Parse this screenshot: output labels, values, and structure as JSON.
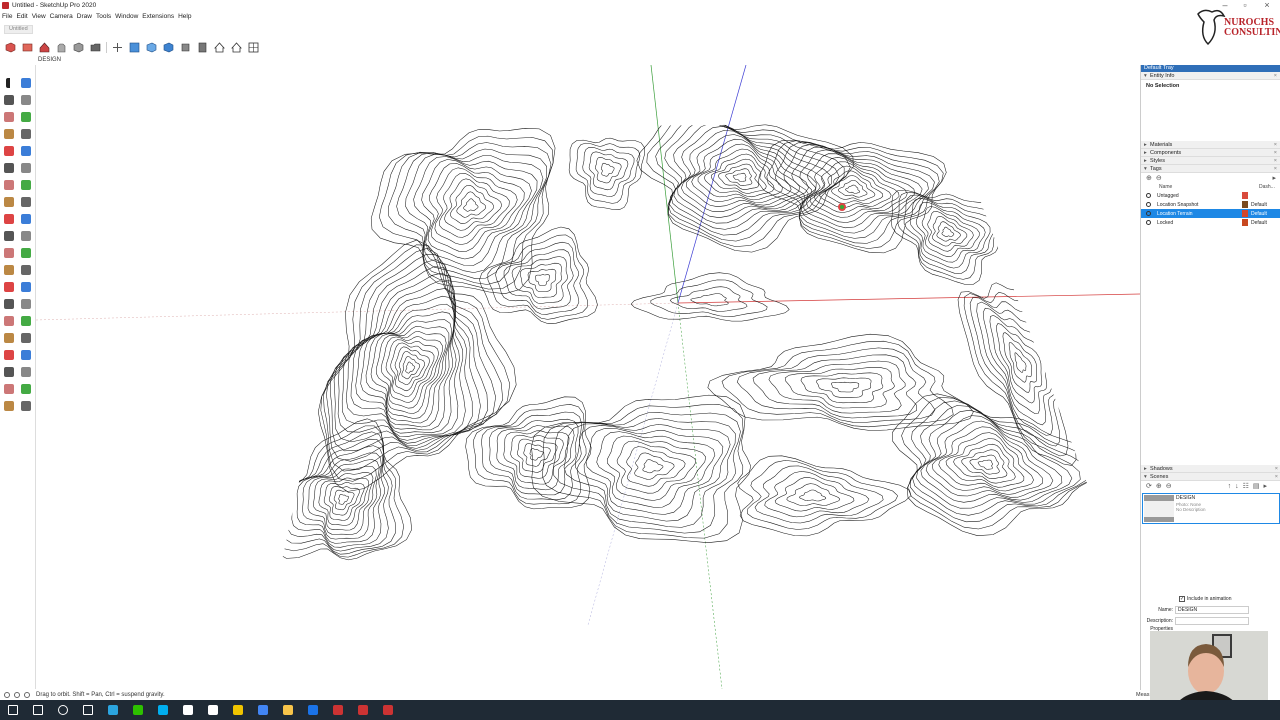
{
  "window": {
    "title": "Untitled - SketchUp Pro 2020"
  },
  "menu": [
    "File",
    "Edit",
    "View",
    "Camera",
    "Draw",
    "Tools",
    "Window",
    "Extensions",
    "Help"
  ],
  "doc_tab": "Untitled",
  "scene_tab": "DESIGN",
  "toolbar_icons": [
    "cube-icon",
    "wall-icon",
    "house-roof-icon",
    "hand-orbit-icon",
    "box-icon",
    "folder-icon",
    "axes-icon",
    "iso-view-icon",
    "top-view-icon",
    "front-view-icon",
    "right-view-icon",
    "back-view-icon",
    "left-view-icon",
    "home-icon",
    "house-icon",
    "grid-icon"
  ],
  "left_tools": [
    [
      "select-icon",
      "eraser-icon"
    ],
    [
      "paint-bucket-icon",
      "eraser-pink-icon"
    ],
    [
      "line-icon",
      "freehand-icon"
    ],
    [
      "rectangle-icon",
      "rotated-rect-icon"
    ],
    [
      "circle-icon",
      "polygon-icon"
    ],
    [
      "arc-icon",
      "pie-icon"
    ],
    [
      "arc2-icon",
      "arc3-icon"
    ],
    [
      "move-icon",
      "push-pull-icon"
    ],
    [
      "rotate-icon",
      "follow-me-icon"
    ],
    [
      "scale-icon",
      "offset-icon"
    ],
    [
      "tape-measure-icon",
      "text-icon"
    ],
    [
      "protractor-icon",
      "3d-text-icon"
    ],
    [
      "axes-tool-icon",
      "dimension-icon"
    ],
    [
      "orbit-icon",
      "pan-icon"
    ],
    [
      "zoom-icon",
      "zoom-window-icon"
    ],
    [
      "zoom-extents-icon",
      "position-camera-icon"
    ],
    [
      "walk-icon",
      "look-around-icon"
    ],
    [
      "section-plane-icon",
      "section-display-icon"
    ],
    [
      "sandbox-icon",
      "sandbox-scoop-icon"
    ],
    [
      "warehouse-icon",
      "extension-icon"
    ]
  ],
  "tray": {
    "title": "Default Tray",
    "entity_info": {
      "header": "Entity Info",
      "selection": "No Selection"
    },
    "panels": [
      "Materials",
      "Components",
      "Styles",
      "Tags"
    ],
    "tags": {
      "col_name": "Name",
      "col_dash": "Dash...",
      "rows": [
        {
          "name": "Untagged",
          "dash": "",
          "color": "#d94a3c",
          "selected": false
        },
        {
          "name": "Location Snapshot",
          "dash": "Default",
          "color": "#7a4a1e",
          "selected": false
        },
        {
          "name": "Location Terrain",
          "dash": "Default",
          "color": "#d2462c",
          "selected": true
        },
        {
          "name": "Locked",
          "dash": "Default",
          "color": "#c84820",
          "selected": false
        }
      ]
    },
    "shadows": "Shadows",
    "scenes": {
      "header": "Scenes",
      "card": {
        "name": "DESIGN",
        "photo": "Photo: None",
        "desc": "No Description"
      },
      "include": "Include in animation",
      "name_label": "Name:",
      "name_value": "DESIGN",
      "desc_label": "Description:",
      "props_label": "Properties"
    }
  },
  "status": {
    "hint": "Drag to orbit. Shift = Pan, Ctrl = suspend gravity.",
    "measure": "Meas"
  },
  "logo_text": [
    "NUROCHS",
    "CONSULTING"
  ],
  "taskbar": [
    "windows-start-icon",
    "search-icon",
    "cortana-icon",
    "task-view-icon",
    "telegram-icon",
    "wechat-icon",
    "skype-icon",
    "store-icon",
    "settings-icon",
    "files-icon",
    "chrome-icon",
    "explorer-icon",
    "chrome-alt-icon",
    "sketchup-icon",
    "sketchup2-icon",
    "sketchup3-icon"
  ]
}
